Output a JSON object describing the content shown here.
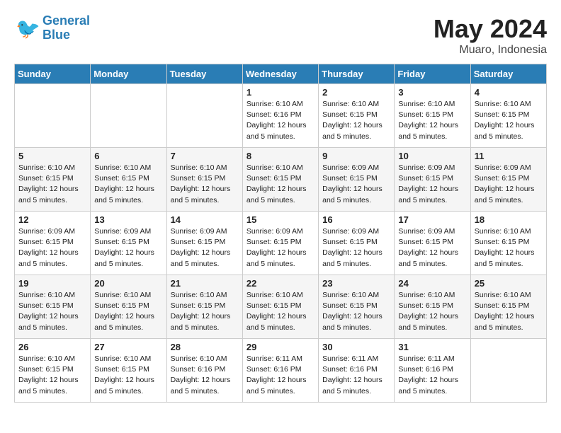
{
  "logo": {
    "text_general": "General",
    "text_blue": "Blue"
  },
  "title": "May 2024",
  "subtitle": "Muaro, Indonesia",
  "weekdays": [
    "Sunday",
    "Monday",
    "Tuesday",
    "Wednesday",
    "Thursday",
    "Friday",
    "Saturday"
  ],
  "weeks": [
    [
      {
        "day": "",
        "info": ""
      },
      {
        "day": "",
        "info": ""
      },
      {
        "day": "",
        "info": ""
      },
      {
        "day": "1",
        "info": "Sunrise: 6:10 AM\nSunset: 6:16 PM\nDaylight: 12 hours\nand 5 minutes."
      },
      {
        "day": "2",
        "info": "Sunrise: 6:10 AM\nSunset: 6:15 PM\nDaylight: 12 hours\nand 5 minutes."
      },
      {
        "day": "3",
        "info": "Sunrise: 6:10 AM\nSunset: 6:15 PM\nDaylight: 12 hours\nand 5 minutes."
      },
      {
        "day": "4",
        "info": "Sunrise: 6:10 AM\nSunset: 6:15 PM\nDaylight: 12 hours\nand 5 minutes."
      }
    ],
    [
      {
        "day": "5",
        "info": "Sunrise: 6:10 AM\nSunset: 6:15 PM\nDaylight: 12 hours\nand 5 minutes."
      },
      {
        "day": "6",
        "info": "Sunrise: 6:10 AM\nSunset: 6:15 PM\nDaylight: 12 hours\nand 5 minutes."
      },
      {
        "day": "7",
        "info": "Sunrise: 6:10 AM\nSunset: 6:15 PM\nDaylight: 12 hours\nand 5 minutes."
      },
      {
        "day": "8",
        "info": "Sunrise: 6:10 AM\nSunset: 6:15 PM\nDaylight: 12 hours\nand 5 minutes."
      },
      {
        "day": "9",
        "info": "Sunrise: 6:09 AM\nSunset: 6:15 PM\nDaylight: 12 hours\nand 5 minutes."
      },
      {
        "day": "10",
        "info": "Sunrise: 6:09 AM\nSunset: 6:15 PM\nDaylight: 12 hours\nand 5 minutes."
      },
      {
        "day": "11",
        "info": "Sunrise: 6:09 AM\nSunset: 6:15 PM\nDaylight: 12 hours\nand 5 minutes."
      }
    ],
    [
      {
        "day": "12",
        "info": "Sunrise: 6:09 AM\nSunset: 6:15 PM\nDaylight: 12 hours\nand 5 minutes."
      },
      {
        "day": "13",
        "info": "Sunrise: 6:09 AM\nSunset: 6:15 PM\nDaylight: 12 hours\nand 5 minutes."
      },
      {
        "day": "14",
        "info": "Sunrise: 6:09 AM\nSunset: 6:15 PM\nDaylight: 12 hours\nand 5 minutes."
      },
      {
        "day": "15",
        "info": "Sunrise: 6:09 AM\nSunset: 6:15 PM\nDaylight: 12 hours\nand 5 minutes."
      },
      {
        "day": "16",
        "info": "Sunrise: 6:09 AM\nSunset: 6:15 PM\nDaylight: 12 hours\nand 5 minutes."
      },
      {
        "day": "17",
        "info": "Sunrise: 6:09 AM\nSunset: 6:15 PM\nDaylight: 12 hours\nand 5 minutes."
      },
      {
        "day": "18",
        "info": "Sunrise: 6:10 AM\nSunset: 6:15 PM\nDaylight: 12 hours\nand 5 minutes."
      }
    ],
    [
      {
        "day": "19",
        "info": "Sunrise: 6:10 AM\nSunset: 6:15 PM\nDaylight: 12 hours\nand 5 minutes."
      },
      {
        "day": "20",
        "info": "Sunrise: 6:10 AM\nSunset: 6:15 PM\nDaylight: 12 hours\nand 5 minutes."
      },
      {
        "day": "21",
        "info": "Sunrise: 6:10 AM\nSunset: 6:15 PM\nDaylight: 12 hours\nand 5 minutes."
      },
      {
        "day": "22",
        "info": "Sunrise: 6:10 AM\nSunset: 6:15 PM\nDaylight: 12 hours\nand 5 minutes."
      },
      {
        "day": "23",
        "info": "Sunrise: 6:10 AM\nSunset: 6:15 PM\nDaylight: 12 hours\nand 5 minutes."
      },
      {
        "day": "24",
        "info": "Sunrise: 6:10 AM\nSunset: 6:15 PM\nDaylight: 12 hours\nand 5 minutes."
      },
      {
        "day": "25",
        "info": "Sunrise: 6:10 AM\nSunset: 6:15 PM\nDaylight: 12 hours\nand 5 minutes."
      }
    ],
    [
      {
        "day": "26",
        "info": "Sunrise: 6:10 AM\nSunset: 6:15 PM\nDaylight: 12 hours\nand 5 minutes."
      },
      {
        "day": "27",
        "info": "Sunrise: 6:10 AM\nSunset: 6:15 PM\nDaylight: 12 hours\nand 5 minutes."
      },
      {
        "day": "28",
        "info": "Sunrise: 6:10 AM\nSunset: 6:16 PM\nDaylight: 12 hours\nand 5 minutes."
      },
      {
        "day": "29",
        "info": "Sunrise: 6:11 AM\nSunset: 6:16 PM\nDaylight: 12 hours\nand 5 minutes."
      },
      {
        "day": "30",
        "info": "Sunrise: 6:11 AM\nSunset: 6:16 PM\nDaylight: 12 hours\nand 5 minutes."
      },
      {
        "day": "31",
        "info": "Sunrise: 6:11 AM\nSunset: 6:16 PM\nDaylight: 12 hours\nand 5 minutes."
      },
      {
        "day": "",
        "info": ""
      }
    ]
  ]
}
